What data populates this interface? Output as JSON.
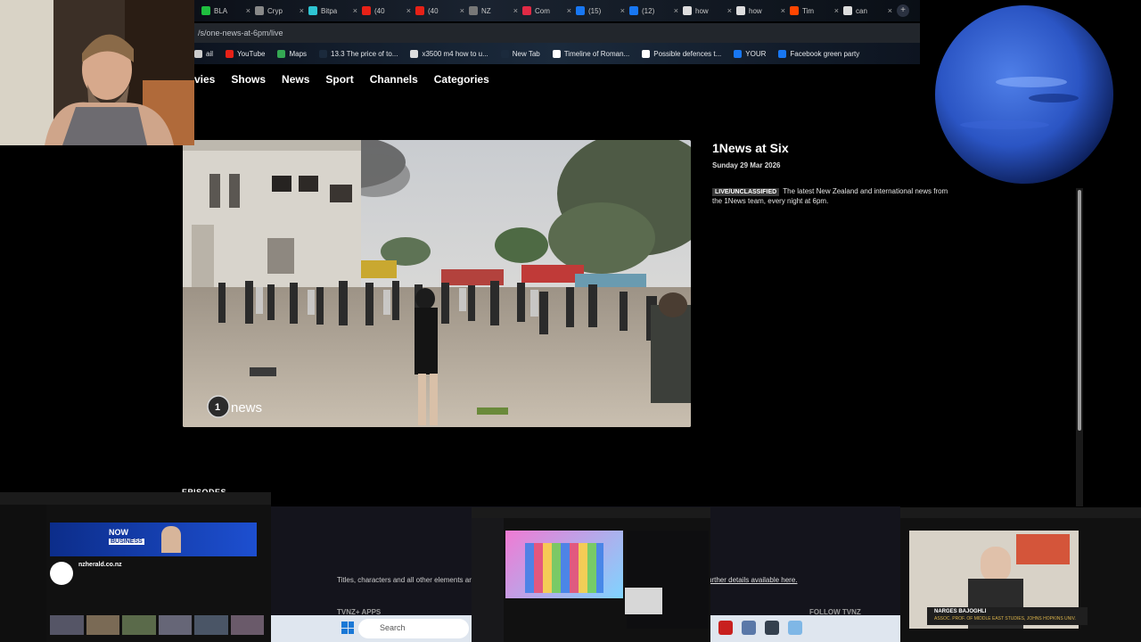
{
  "browser": {
    "tabs": [
      {
        "label": "BLA",
        "color": "#1fbf3f"
      },
      {
        "label": "Cryp",
        "color": "#888888"
      },
      {
        "label": "Bitpa",
        "color": "#2ec5d3"
      },
      {
        "label": "(40",
        "color": "#e62117"
      },
      {
        "label": "(40",
        "color": "#e62117"
      },
      {
        "label": "NZ",
        "color": "#777777"
      },
      {
        "label": "Com",
        "color": "#e02a45"
      },
      {
        "label": "(15)",
        "color": "#1877f2"
      },
      {
        "label": "(12)",
        "color": "#1877f2"
      },
      {
        "label": "how",
        "color": "#dddddd"
      },
      {
        "label": "how",
        "color": "#dddddd"
      },
      {
        "label": "Tim",
        "color": "#ff4500"
      },
      {
        "label": "can",
        "color": "#dddddd"
      }
    ],
    "url": "/s/one-news-at-6pm/live",
    "bookmarks": [
      {
        "label": "ail",
        "color": "#cccccc"
      },
      {
        "label": "YouTube",
        "color": "#e62117"
      },
      {
        "label": "Maps",
        "color": "#34a853"
      },
      {
        "label": "13.3 The price of to...",
        "color": "#1b2a3c"
      },
      {
        "label": "x3500 m4 how to u...",
        "color": "#dddddd"
      },
      {
        "label": "New Tab",
        "color": "#1b2a3c"
      },
      {
        "label": "Timeline of Roman...",
        "color": "#ffffff"
      },
      {
        "label": "Possible defences t...",
        "color": "#ffffff"
      },
      {
        "label": "YOUR",
        "color": "#1877f2"
      },
      {
        "label": "Facebook green party",
        "color": "#1877f2"
      }
    ]
  },
  "nav": {
    "items": [
      "vies",
      "Shows",
      "News",
      "Sport",
      "Channels",
      "Categories"
    ]
  },
  "video": {
    "watermark": "news"
  },
  "show": {
    "title": "1News at Six",
    "date": "Sunday 29 Mar 2026",
    "badge": "LIVE/UNCLASSIFIED",
    "description": "The latest New Zealand and international news from the 1News team, every night at 6pm."
  },
  "episodes_label": "EPISODES",
  "footer": {
    "notice": "Titles, characters and all other elements are",
    "link": "urther details available here.",
    "apps": "TVNZ+ APPS",
    "follow": "FOLLOW TVNZ"
  },
  "taskbar": {
    "search_placeholder": "Search"
  },
  "pip_left": {
    "banner_now": "NOW",
    "banner_business": "BUSINESS",
    "channel": "nzherald.co.nz"
  },
  "pip_right": {
    "name": "NARGES BAJOGHLI",
    "role": "ASSOC. PROF. OF MIDDLE EAST STUDIES, JOHNS HOPKINS UNIV."
  }
}
